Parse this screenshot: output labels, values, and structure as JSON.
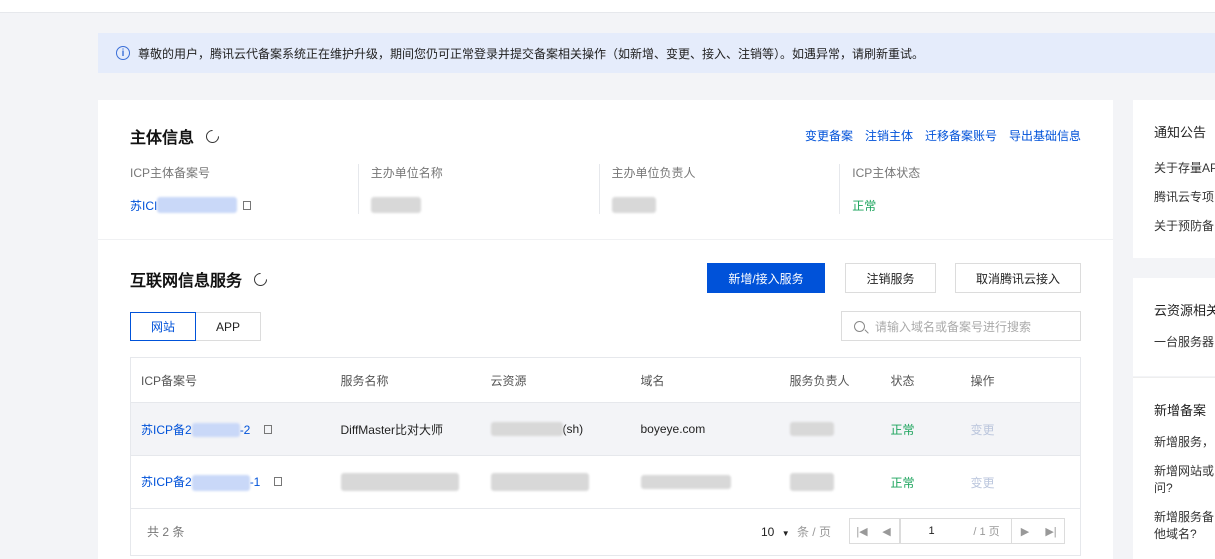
{
  "notice": {
    "text": "尊敬的用户，腾讯云代备案系统正在维护升级，期间您仍可正常登录并提交备案相关操作（如新增、变更、接入、注销等）。如遇异常，请刷新重试。"
  },
  "subject": {
    "title": "主体信息",
    "links": [
      "变更备案",
      "注销主体",
      "迁移备案账号",
      "导出基础信息"
    ],
    "fields": [
      {
        "label": "ICP主体备案号",
        "value_prefix": "苏ICI"
      },
      {
        "label": "主办单位名称"
      },
      {
        "label": "主办单位负责人"
      },
      {
        "label": "ICP主体状态",
        "value": "正常"
      }
    ]
  },
  "services": {
    "title": "互联网信息服务",
    "buttons": {
      "add": "新增/接入服务",
      "cancel": "注销服务",
      "unlink": "取消腾讯云接入"
    },
    "tabs": [
      "网站",
      "APP"
    ],
    "search_placeholder": "请输入域名或备案号进行搜索",
    "columns": [
      "ICP备案号",
      "服务名称",
      "云资源",
      "域名",
      "服务负责人",
      "状态",
      "操作"
    ],
    "rows": [
      {
        "icp_prefix": "苏ICP备2",
        "icp_suffix": "-2",
        "name": "DiffMaster比对大师",
        "cloud_suffix": "(sh)",
        "domain": "boyeye.com",
        "status": "正常",
        "action": "变更"
      },
      {
        "icp_prefix": "苏ICP备2",
        "icp_suffix": "-1",
        "name": "",
        "cloud_suffix": "",
        "domain": "",
        "status": "正常",
        "action": "变更"
      }
    ],
    "pagination": {
      "total": "共 2 条",
      "page_size": "10",
      "page_size_unit": "条 / 页",
      "page": "1",
      "pages": "/ 1 页"
    }
  },
  "sidebar": {
    "notice": {
      "title": "通知公告",
      "items": [
        "关于存量AP",
        "腾讯云专项",
        "关于预防备"
      ]
    },
    "cloud": {
      "title": "云资源相关",
      "items": [
        "一台服务器"
      ]
    },
    "new": {
      "title": "新增备案",
      "items": [
        "新增服务，",
        "新增网站或",
        "问?",
        "新增服务备",
        "他域名?"
      ]
    }
  }
}
